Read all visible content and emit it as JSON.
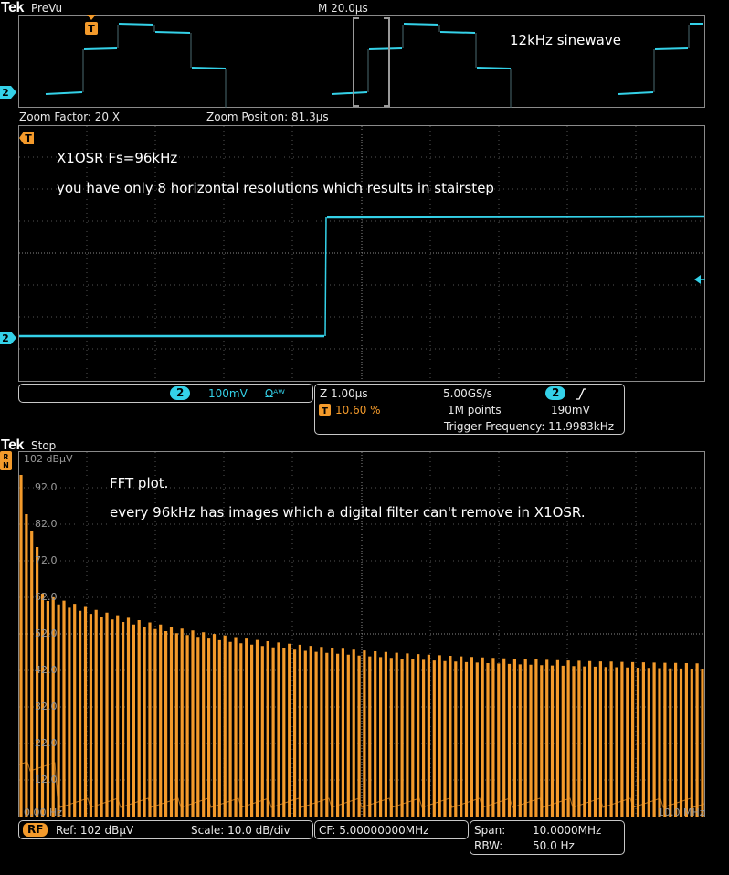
{
  "top": {
    "logo": "Tek",
    "mode": "PreVu",
    "timebase": "M 20.0µs",
    "annotation": "12kHz sinewave"
  },
  "zoom_info": {
    "factor": "Zoom Factor: 20 X",
    "position": "Zoom Position: 81.3µs"
  },
  "zoom": {
    "annotation1": "X1OSR   Fs=96kHz",
    "annotation2": "you have only 8 horizontal resolutions  which results in stairstep"
  },
  "channel_bar": {
    "channel": "2",
    "scale": "100mV",
    "coupling": "Ωᴬᵂ"
  },
  "acq_bar": {
    "zoom_time": "Z 1.00µs",
    "trigger_pos": "10.60 %",
    "sample_rate": "5.00GS/s",
    "points": "1M points",
    "trig_channel": "2",
    "trig_level": "190mV",
    "trig_freq": "Trigger Frequency: 11.9983kHz"
  },
  "fft_header": {
    "logo": "Tek",
    "mode": "Stop"
  },
  "fft": {
    "annotation1": "FFT plot.",
    "annotation2": "every 96kHz has images which a digital filter can't remove in X1OSR.",
    "y_top_label": "102 dBµV",
    "y_ticks": [
      "92.0",
      "82.0",
      "72.0",
      "62.0",
      "52.0",
      "42.0",
      "32.0",
      "22.0",
      "12.0"
    ],
    "x_start": "0.00 Hz",
    "x_end": "10.0 MHz"
  },
  "fft_bar": {
    "rf_label": "RF",
    "ref": "Ref: 102 dBµV",
    "scale": "Scale: 10.0 dB/div",
    "cf": "CF:   5.00000000MHz",
    "span_label": "Span:",
    "span_value": "10.0000MHz",
    "rbw_label": "RBW:",
    "rbw_value": "50.0 Hz"
  },
  "colors": {
    "trace_cyan": "#34d1e8",
    "trace_orange": "#f39a2b",
    "graticule": "#8a8a8a"
  },
  "icons": [
    "trigger-marker-icon",
    "channel2-marker-icon",
    "trigger-level-arrow-icon",
    "rising-edge-icon"
  ]
}
